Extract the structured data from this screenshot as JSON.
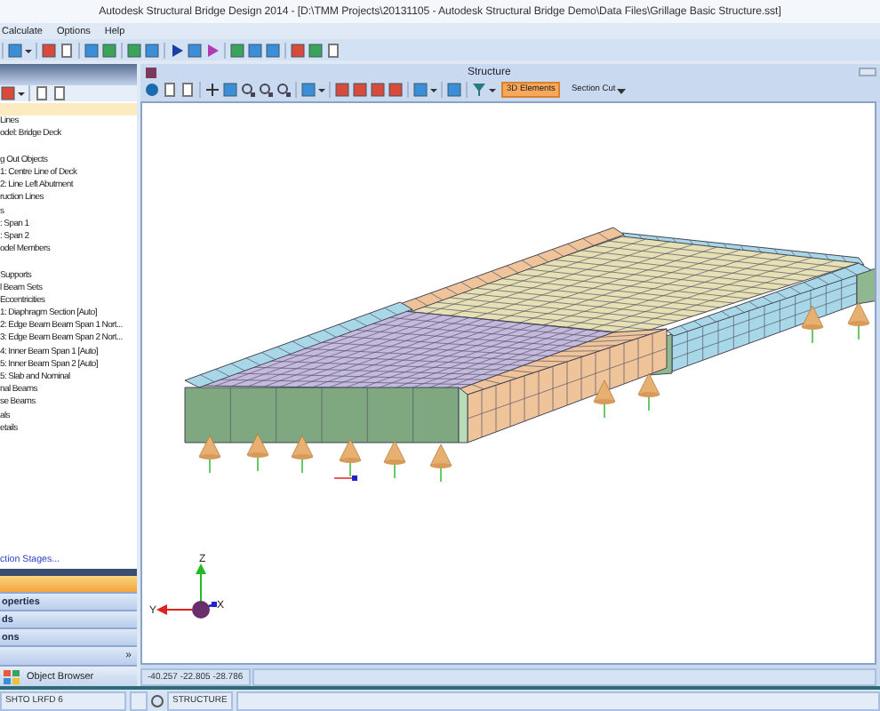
{
  "window": {
    "title": "Autodesk Structural Bridge Design 2014 - [D:\\TMM Projects\\20131105 - Autodesk Structural Bridge Demo\\Data Files\\Grillage Basic Structure.sst]"
  },
  "menu": [
    {
      "label": "Calculate"
    },
    {
      "label": "Options"
    },
    {
      "label": "Help"
    }
  ],
  "left_panel": {
    "tree": [
      {
        "selected": true
      },
      {
        "label": "Lines",
        "selected": false
      },
      {
        "label": "odel: Bridge Deck",
        "selected": false
      },
      {
        "selected": false
      },
      {
        "label": "g Out Objects",
        "selected": false
      },
      {
        "label": "1: Centre Line of Deck",
        "selected": false
      },
      {
        "label": "2: Line Left Abutment",
        "selected": false
      },
      {
        "label": "ruction Lines",
        "selected": false
      },
      {
        "label": "s",
        "selected": false
      },
      {
        "label": ": Span 1",
        "selected": false
      },
      {
        "label": ": Span 2",
        "selected": false
      },
      {
        "label": "odel Members",
        "selected": false
      },
      {
        "selected": false
      },
      {
        "label": "Supports",
        "selected": false
      },
      {
        "label": "l Beam Sets",
        "selected": false
      },
      {
        "label": "Eccentricities",
        "selected": false
      },
      {
        "label": "1: Diaphragm Section [Auto]",
        "selected": false
      },
      {
        "label": "2: Edge Beam  Beam Span 1 Nort...",
        "selected": false
      },
      {
        "label": "3: Edge Beam  Beam Span 2 Nort...",
        "selected": false
      },
      {
        "label": "4: Inner Beam Span 1 [Auto]",
        "selected": false
      },
      {
        "label": "5: Inner Beam Span 2 [Auto]",
        "selected": false
      },
      {
        "label": "5: Slab and Nominal",
        "selected": false
      },
      {
        "label": "nal Beams",
        "selected": false
      },
      {
        "label": "se Beams",
        "selected": false
      },
      {
        "label": "als",
        "selected": false
      },
      {
        "label": "etails",
        "selected": false
      }
    ],
    "link": "ction Stages...",
    "nav": [
      {
        "selected": true
      },
      {
        "label": "operties",
        "selected": false
      },
      {
        "label": "ds",
        "selected": false
      },
      {
        "label": "ons",
        "selected": false
      }
    ],
    "more_button": "»",
    "object_browser": "Object Browser"
  },
  "viewport": {
    "title": "Structure",
    "tools": [
      {
        "label": "3D Elements",
        "selected": true,
        "dropdown": false
      },
      {
        "label": "Section Cut",
        "selected": false,
        "dropdown": true
      }
    ],
    "axes": [
      "Z",
      "Y",
      "X"
    ],
    "coordinates": "-40.257 -22.805 -28.786"
  },
  "status_bar": {
    "standard": "SHTO LRFD 6",
    "mode": "STRUCTURE"
  }
}
